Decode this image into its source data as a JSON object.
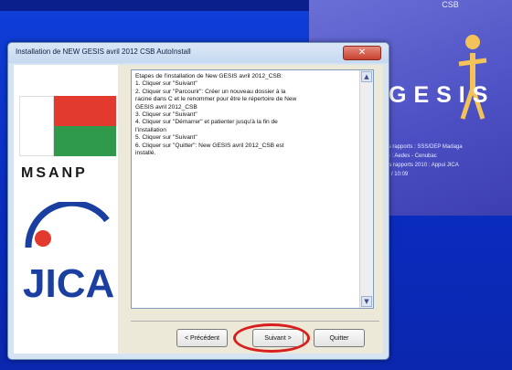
{
  "splash": {
    "header": "CSB",
    "logo_text": "GESIS",
    "info_lines": [
      "nis rapports : SSS/DEP Madaga",
      "ne : Aedes - Cenubac",
      "urs rapports 2010 : Appui JICA",
      "11 / 10:09"
    ]
  },
  "window": {
    "title": "Installation de NEW GESIS avril 2012 CSB AutoInstall",
    "close_glyph": "✕"
  },
  "branding": {
    "org_name": "MSANP",
    "partner_logo_text": "JICA",
    "flag_colors": {
      "white": "#ffffff",
      "red": "#e23a2e",
      "green": "#2f9a4c"
    }
  },
  "instructions": [
    "Etapes de l'installation de New GESIS avril 2012_CSB:",
    "1. Cliquer sur \"Suivant\"",
    "2. Cliquer sur \"Parcourir\": Créer un nouveau dossier à la",
    "racine dans C et le renommer pour être le répertoire de New",
    "GESIS avril 2012_CSB",
    "3. Cliquer sur \"Suivant\"",
    "4. Cliquer sur \"Démarrer\" et patienter jusqu'à la fin de",
    "l'installation",
    "5. Cliquer sur \"Suivant\"",
    "6. Cliquer sur \"Quitter\": New GESIS avril 2012_CSB est",
    "installé."
  ],
  "buttons": {
    "previous": "< Précédent",
    "next": "Suivant >",
    "quit": "Quitter"
  },
  "colors": {
    "desktop": "#0a2fbf",
    "highlight_ring": "#d81f1f"
  }
}
